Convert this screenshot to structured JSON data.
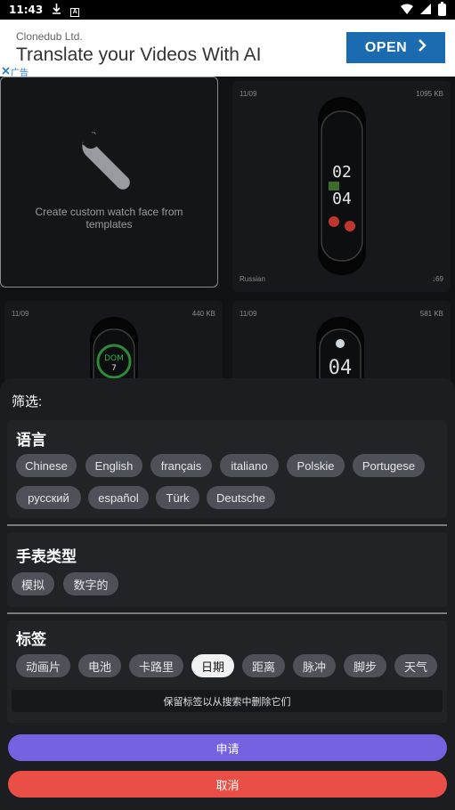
{
  "status_bar": {
    "time": "11:43",
    "icons": [
      "download-icon",
      "a-box-icon",
      "wifi-icon",
      "signal-icon",
      "battery-icon"
    ]
  },
  "ad": {
    "company": "Clonedub Ltd.",
    "headline": "Translate your Videos With AI",
    "button_label": "OPEN",
    "marker": "广告"
  },
  "grid": {
    "create_card": {
      "text": "Create custom watch face from templates"
    },
    "cards": [
      {
        "date": "11/09",
        "size": "1095 KB",
        "language": "Russian",
        "downloads": "69"
      },
      {
        "date": "11/09",
        "size": "440 KB",
        "watch_text": "DOM",
        "watch_num": "7"
      },
      {
        "date": "11/09",
        "size": "581 KB",
        "watch_text": "04"
      }
    ]
  },
  "filter_sheet": {
    "title": "筛选:",
    "language_section": {
      "title": "语言",
      "chips": [
        "Chinese",
        "English",
        "français",
        "italiano",
        "Polskie",
        "Portugese",
        "русский",
        "español",
        "Türk",
        "Deutsche"
      ]
    },
    "watch_type_section": {
      "title": "手表类型",
      "chips": [
        "模拟",
        "数字的"
      ]
    },
    "tags_section": {
      "title": "标签",
      "chips": [
        "动画片",
        "电池",
        "卡路里",
        "日期",
        "距离",
        "脉冲",
        "脚步",
        "天气"
      ],
      "selected": "日期",
      "hint": "保留标签以从搜索中删除它们"
    },
    "apply_label": "申请",
    "cancel_label": "取消"
  },
  "colors": {
    "apply": "#7462e0",
    "cancel": "#ea4f47",
    "chip": "#4f5158",
    "chip_selected": "#f2f2f2",
    "ad_button": "#1a6bb0"
  }
}
